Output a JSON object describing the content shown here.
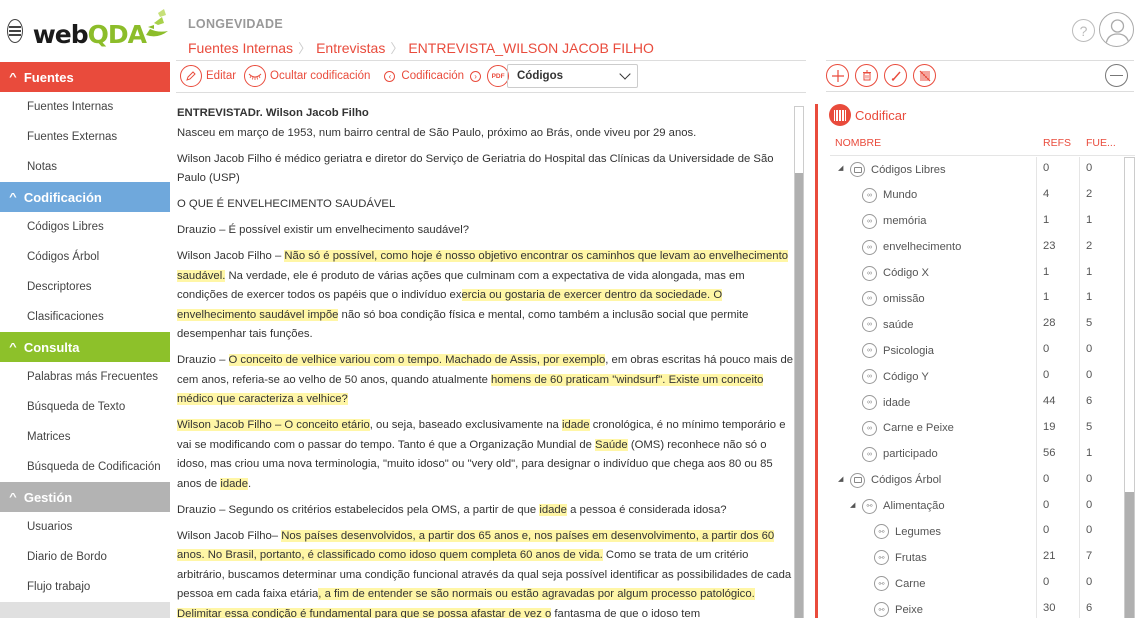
{
  "app": {
    "logo_web": "web",
    "logo_qda": "QDA"
  },
  "sidebar": {
    "sections": [
      {
        "label": "Fuentes",
        "color": "#e94b3c",
        "items": [
          "Fuentes Internas",
          "Fuentes Externas",
          "Notas"
        ]
      },
      {
        "label": "Codificación",
        "color": "#6fa8dc",
        "items": [
          "Códigos Libres",
          "Códigos Árbol",
          "Descriptores",
          "Clasificaciones"
        ]
      },
      {
        "label": "Consulta",
        "color": "#8dc12a",
        "items": [
          "Palabras más Frecuentes",
          "Búsqueda de Texto",
          "Matrices",
          "Búsqueda de Codificación"
        ]
      },
      {
        "label": "Gestión",
        "color": "#b3b3b3",
        "items": [
          "Usuarios",
          "Diario de Bordo",
          "Flujo trabajo"
        ]
      }
    ]
  },
  "header": {
    "project": "LONGEVIDADE",
    "breadcrumb": [
      "Fuentes Internas",
      "Entrevistas",
      "ENTREVISTA_WILSON JACOB FILHO"
    ],
    "help_icon": "?"
  },
  "toolbar": {
    "edit": "Editar",
    "hide_coding": "Ocultar codificación",
    "coding_nav": "Codificación",
    "prev_icon": "‹",
    "next_icon": "›",
    "pdf": "PDF",
    "select_value": "Códigos"
  },
  "document": {
    "title": "ENTREVISTADr. Wilson Jacob Filho",
    "paragraphs": [
      [
        {
          "t": "Nasceu em março de 1953, num bairro central de São Paulo, próximo ao Brás, onde viveu por 29 anos."
        }
      ],
      [
        {
          "t": "Wilson Jacob Filho é médico geriatra e diretor do Serviço de Geriatria do Hospital das Clínicas da Universidade de São Paulo (USP)"
        }
      ],
      [
        {
          "t": "O QUE É ENVELHECIMENTO SAUDÁVEL"
        }
      ],
      [
        {
          "t": "Drauzio – É possível existir um envelhecimento saudável?"
        }
      ],
      [
        {
          "t": "Wilson Jacob Filho – "
        },
        {
          "t": "Não só é possível, como hoje é nosso objetivo encontrar os caminhos que levam ao envelhecimento saudável.",
          "h": true
        },
        {
          "t": " Na verdade, ele é produto de várias ações que culminam com a expectativa de vida alongada, mas em condições de exercer todos os papéis que o indivíduo ex"
        },
        {
          "t": "ercia ou gostaria de exercer dentro da sociedade. O envelhecimento saudável impõe",
          "h": true
        },
        {
          "t": " não só boa condição física e mental, como também a inclusão social que permite desempenhar tais funções."
        }
      ],
      [
        {
          "t": "Drauzio – "
        },
        {
          "t": "O conceito de velhice variou com o tempo. Machado de Assis, por exemplo",
          "h": true
        },
        {
          "t": ", em obras escritas há pouco mais de cem anos, referia-se ao velho de 50 anos, quando atualmente "
        },
        {
          "t": "homens de 60 praticam \"windsurf\". Existe um conceito médico que caracteriza a velhice?",
          "h": true
        }
      ],
      [
        {
          "t": " Wilson Jacob Filho – O conceito etário",
          "h": true
        },
        {
          "t": ", ou seja, baseado exclusivamente na "
        },
        {
          "t": "idade",
          "h": true
        },
        {
          "t": " cronológica, é no mínimo temporário e vai se modificando com o passar do tempo. Tanto é que a Organização Mundial de "
        },
        {
          "t": "Saúde",
          "h": true
        },
        {
          "t": " (OMS) reconhece não só o idoso, mas criou uma nova terminologia, \"muito idoso\" ou \"very old\", para designar o indivíduo que chega aos 80 ou 85 anos de "
        },
        {
          "t": "idade",
          "h": true
        },
        {
          "t": "."
        }
      ],
      [
        {
          "t": "Drauzio – Segundo os critérios estabelecidos pela OMS, a partir de que "
        },
        {
          "t": "idade",
          "h": true
        },
        {
          "t": " a pessoa é considerada idosa?"
        }
      ],
      [
        {
          "t": "Wilson Jacob Filho– "
        },
        {
          "t": "Nos países desenvolvidos, a partir dos 65 anos e, nos países em desenvolvimento, a partir dos 60 anos. No Brasil, portanto, é classificado como idoso quem completa 60 anos de vida.",
          "h": true
        },
        {
          "t": " Como se trata de um critério arbitrário, buscamos determinar uma condição funcional através da qual seja possível identificar as possibilidades de cada pessoa em cada faixa etária"
        },
        {
          "t": ", a fim de entender se são normais ou estão agravadas por algum processo patológico. Delimitar essa condição é fundamental para que se possa afastar de vez o",
          "h": true
        },
        {
          "t": " fantasma de que o idoso tem"
        }
      ]
    ]
  },
  "right_panel": {
    "title": "Codificar",
    "columns": {
      "name": "NOMBRE",
      "refs": "REFS",
      "fue": "FUE..."
    },
    "rows": [
      {
        "name": "Códigos Libres",
        "level": 0,
        "type": "folder",
        "expanded": true,
        "refs": "0",
        "fue": "0"
      },
      {
        "name": "Mundo",
        "level": 1,
        "type": "free",
        "refs": "4",
        "fue": "2"
      },
      {
        "name": "memória",
        "level": 1,
        "type": "free",
        "refs": "1",
        "fue": "1"
      },
      {
        "name": "envelhecimento",
        "level": 1,
        "type": "free",
        "refs": "23",
        "fue": "2"
      },
      {
        "name": "Código X",
        "level": 1,
        "type": "free",
        "refs": "1",
        "fue": "1"
      },
      {
        "name": "omissão",
        "level": 1,
        "type": "free",
        "refs": "1",
        "fue": "1"
      },
      {
        "name": "saúde",
        "level": 1,
        "type": "free",
        "refs": "28",
        "fue": "5"
      },
      {
        "name": "Psicologia",
        "level": 1,
        "type": "free",
        "refs": "0",
        "fue": "0"
      },
      {
        "name": "Código Y",
        "level": 1,
        "type": "free",
        "refs": "0",
        "fue": "0"
      },
      {
        "name": "idade",
        "level": 1,
        "type": "free",
        "refs": "44",
        "fue": "6"
      },
      {
        "name": "Carne e Peixe",
        "level": 1,
        "type": "free",
        "refs": "19",
        "fue": "5"
      },
      {
        "name": "participado",
        "level": 1,
        "type": "free",
        "refs": "56",
        "fue": "1"
      },
      {
        "name": "Códigos Árbol",
        "level": 0,
        "type": "folder",
        "expanded": true,
        "refs": "0",
        "fue": "0"
      },
      {
        "name": "Alimentação",
        "level": 1,
        "type": "tree",
        "expanded": true,
        "refs": "0",
        "fue": "0"
      },
      {
        "name": "Legumes",
        "level": 2,
        "type": "tree",
        "refs": "0",
        "fue": "0"
      },
      {
        "name": "Frutas",
        "level": 2,
        "type": "tree",
        "refs": "21",
        "fue": "7"
      },
      {
        "name": "Carne",
        "level": 2,
        "type": "tree",
        "refs": "0",
        "fue": "0"
      },
      {
        "name": "Peixe",
        "level": 2,
        "type": "tree",
        "refs": "30",
        "fue": "6"
      }
    ]
  },
  "colors": {
    "accent": "#e94b3c",
    "highlight": "#fff6a6",
    "brand_green": "#8cbd2a"
  }
}
